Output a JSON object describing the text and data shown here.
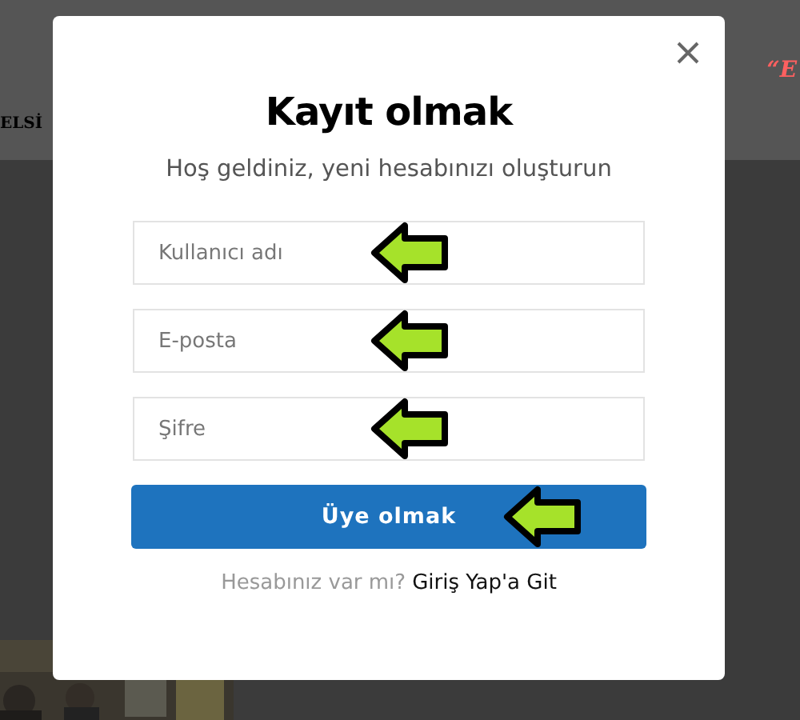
{
  "background": {
    "header_left": "ELSİ",
    "header_right": "“E"
  },
  "dialog": {
    "title": "Kayıt olmak",
    "subtitle": "Hoş geldiniz, yeni hesabınızı oluşturun",
    "fields": [
      {
        "placeholder": "Kullanıcı adı",
        "arrow": true
      },
      {
        "placeholder": "E-posta",
        "arrow": true
      },
      {
        "placeholder": "Şifre",
        "arrow": true
      }
    ],
    "submit": {
      "label": "Üye olmak",
      "arrow": true
    },
    "footer": {
      "question": "Hesabınız var mı?",
      "link": "Giriş Yap'a Git"
    }
  }
}
